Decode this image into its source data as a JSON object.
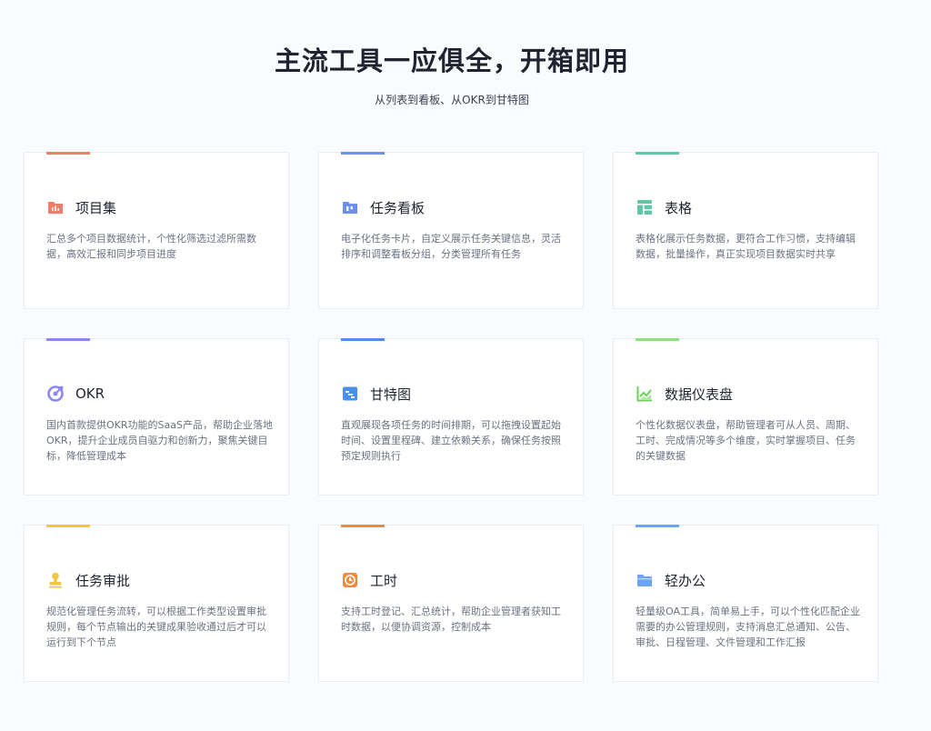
{
  "header": {
    "title": "主流工具一应俱全，开箱即用",
    "subtitle": "从列表到看板、从OKR到甘特图"
  },
  "cards": [
    {
      "title": "项目集",
      "desc": "汇总多个项目数据统计，个性化筛选过滤所需数据，高效汇报和同步项目进度",
      "icon": "project-set-icon",
      "color": "#f07c6b"
    },
    {
      "title": "任务看板",
      "desc": "电子化任务卡片，自定义展示任务关键信息，灵活排序和调整看板分组，分类管理所有任务",
      "icon": "kanban-icon",
      "color": "#6f8ff0"
    },
    {
      "title": "表格",
      "desc": "表格化展示任务数据，更符合工作习惯，支持编辑数据，批量操作，真正实现项目数据实时共享",
      "icon": "table-icon",
      "color": "#5ec7a4"
    },
    {
      "title": "OKR",
      "desc": "国内首款提供OKR功能的SaaS产品，帮助企业落地OKR，提升企业成员自驱力和创新力，聚焦关键目标，降低管理成本",
      "icon": "okr-target-icon",
      "color": "#8b87f0"
    },
    {
      "title": "甘特图",
      "desc": "直观展现各项任务的时间排期，可以拖拽设置起始时间、设置里程碑、建立依赖关系，确保任务按照预定规则执行",
      "icon": "gantt-icon",
      "color": "#4a8fea"
    },
    {
      "title": "数据仪表盘",
      "desc": "个性化数据仪表盘，帮助管理者可从人员、周期、工时、完成情况等多个维度，实时掌握项目、任务的关键数据",
      "icon": "dashboard-chart-icon",
      "color": "#8fe07a"
    },
    {
      "title": "任务审批",
      "desc": "规范化管理任务流转，可以根据工作类型设置审批规则，每个节点输出的关键成果验收通过后才可以运行到下个节点",
      "icon": "approval-stamp-icon",
      "color": "#f4c542"
    },
    {
      "title": "工时",
      "desc": "支持工时登记、汇总统计，帮助企业管理者获知工时数据，以便协调资源，控制成本",
      "icon": "clock-icon",
      "color": "#ef8a3c"
    },
    {
      "title": "轻办公",
      "desc": "轻量级OA工具，简单易上手，可以个性化匹配企业需要的办公管理规则，支持消息汇总通知、公告、审批、日程管理、文件管理和工作汇报",
      "icon": "folder-icon",
      "color": "#6aa5f5"
    }
  ]
}
